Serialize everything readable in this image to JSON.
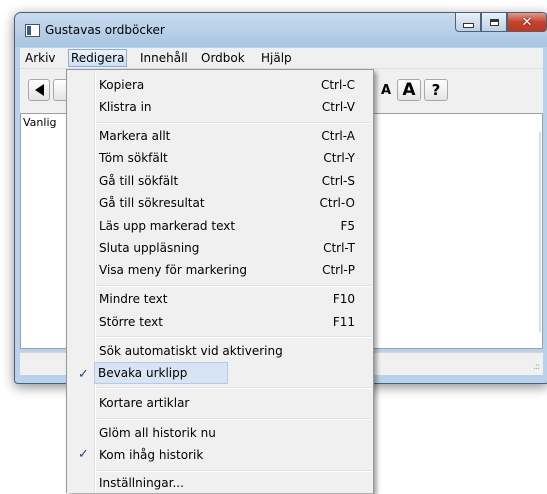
{
  "window": {
    "title": "Gustavas ordböcker",
    "close_glyph": "✕"
  },
  "menubar": [
    "Arkiv",
    "Redigera",
    "Innehåll",
    "Ordbok",
    "Hjälp"
  ],
  "toolbar": {
    "font_small": "A",
    "font_big": "A",
    "help": "?"
  },
  "content": {
    "list_header": "Vanlig"
  },
  "menu": {
    "items": [
      {
        "label": "Kopiera",
        "shortcut": "Ctrl-C"
      },
      {
        "label": "Klistra in",
        "shortcut": "Ctrl-V"
      },
      {
        "label": "Markera allt",
        "shortcut": "Ctrl-A"
      },
      {
        "label": "Töm sökfält",
        "shortcut": "Ctrl-Y"
      },
      {
        "label": "Gå till sökfält",
        "shortcut": "Ctrl-S"
      },
      {
        "label": "Gå till sökresultat",
        "shortcut": "Ctrl-O"
      },
      {
        "label": "Läs upp markerad text",
        "shortcut": "F5"
      },
      {
        "label": "Sluta uppläsning",
        "shortcut": "Ctrl-T"
      },
      {
        "label": "Visa meny för markering",
        "shortcut": "Ctrl-P"
      },
      {
        "label": "Mindre text",
        "shortcut": "F10"
      },
      {
        "label": "Större text",
        "shortcut": "F11"
      },
      {
        "label": "Sök automatiskt vid aktivering",
        "shortcut": ""
      },
      {
        "label": "Bevaka urklipp",
        "shortcut": "",
        "checked": true,
        "highlighted": true
      },
      {
        "label": "Kortare artiklar",
        "shortcut": ""
      },
      {
        "label": "Glöm all historik nu",
        "shortcut": ""
      },
      {
        "label": "Kom ihåg historik",
        "shortcut": "",
        "checked": true
      },
      {
        "label": "Inställningar...",
        "shortcut": ""
      }
    ],
    "check_glyph": "✓"
  },
  "colors": {
    "menu_bg": "#f0f0f0",
    "highlight_bg": "#d8e4f4",
    "check": "#27447a",
    "close_button": "#c3442d"
  }
}
